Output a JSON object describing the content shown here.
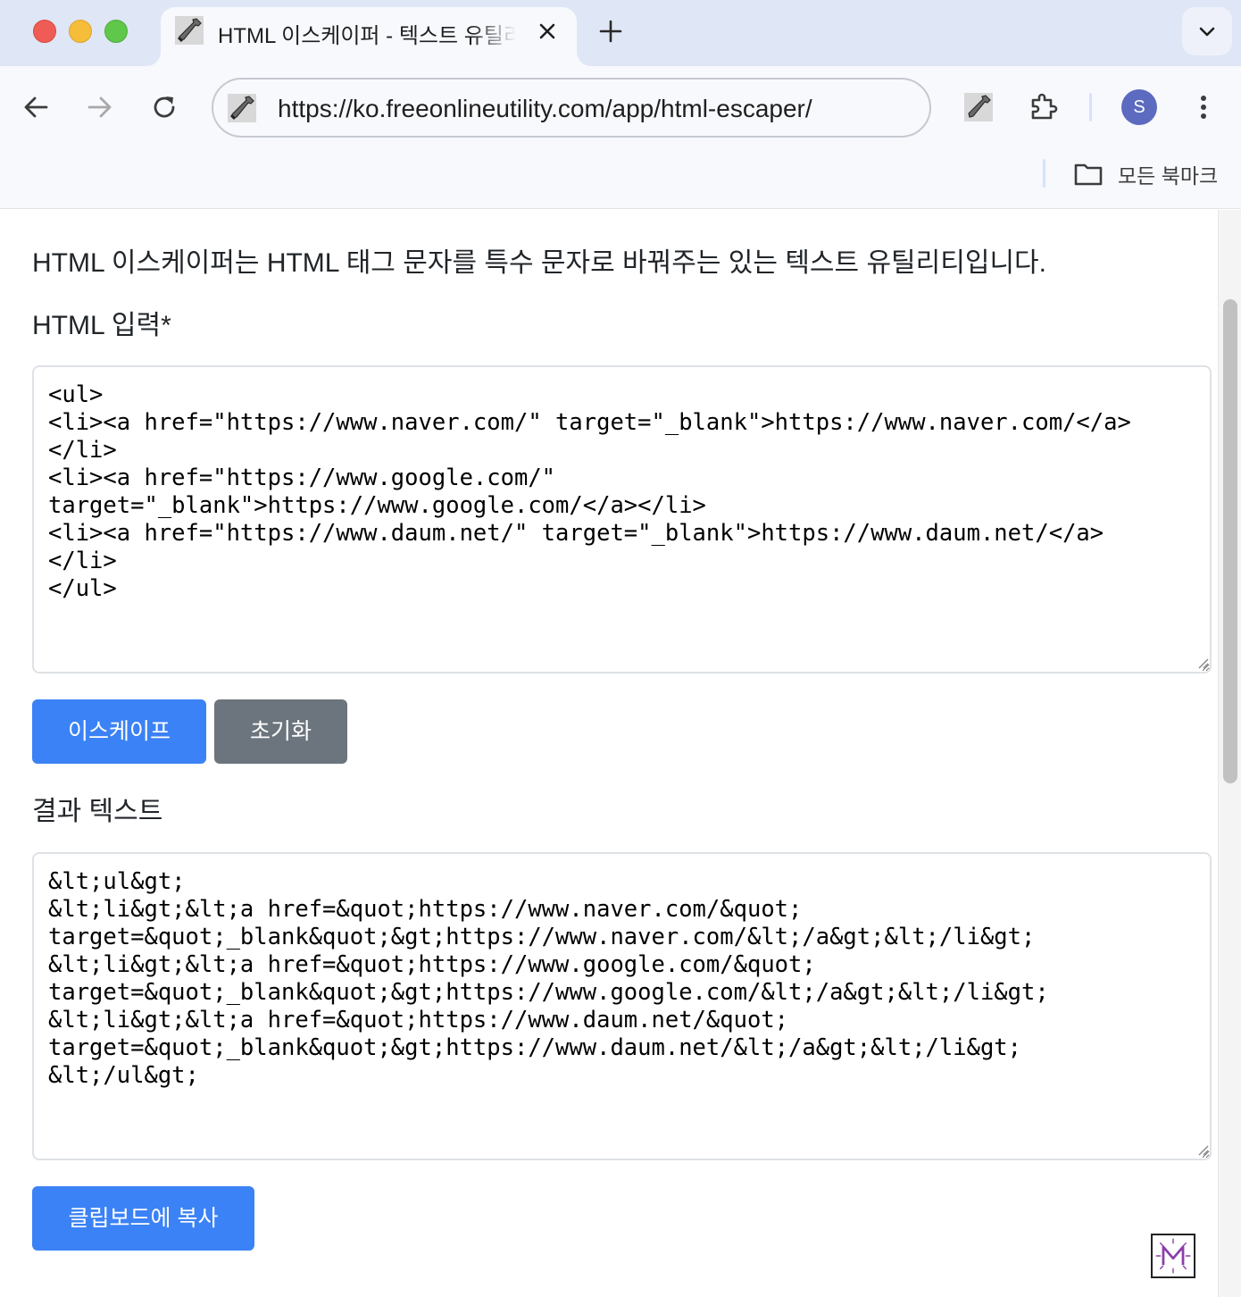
{
  "browser": {
    "tab_title": "HTML 이스케이퍼 - 텍스트 유틸리티",
    "url": "https://ko.freeonlineutility.com/app/html-escaper/",
    "profile_initial": "S",
    "bookmarks_label": "모든 북마크"
  },
  "page": {
    "description": "HTML 이스케이퍼는 HTML 태그 문자를 특수 문자로 바꿔주는 있는 텍스트 유틸리티입니다.",
    "input_label": "HTML 입력*",
    "input_value": "<ul>\n<li><a href=\"https://www.naver.com/\" target=\"_blank\">https://www.naver.com/</a>\n</li>\n<li><a href=\"https://www.google.com/\"\ntarget=\"_blank\">https://www.google.com/</a></li>\n<li><a href=\"https://www.daum.net/\" target=\"_blank\">https://www.daum.net/</a>\n</li>\n</ul>",
    "escape_button": "이스케이프",
    "reset_button": "초기화",
    "result_label": "결과 텍스트",
    "result_value": "&lt;ul&gt;\n&lt;li&gt;&lt;a href=&quot;https://www.naver.com/&quot;\ntarget=&quot;_blank&quot;&gt;https://www.naver.com/&lt;/a&gt;&lt;/li&gt;\n&lt;li&gt;&lt;a href=&quot;https://www.google.com/&quot;\ntarget=&quot;_blank&quot;&gt;https://www.google.com/&lt;/a&gt;&lt;/li&gt;\n&lt;li&gt;&lt;a href=&quot;https://www.daum.net/&quot;\ntarget=&quot;_blank&quot;&gt;https://www.daum.net/&lt;/a&gt;&lt;/li&gt;\n&lt;/ul&gt;",
    "copy_button": "클립보드에 복사"
  },
  "colors": {
    "primary": "#3b82f6",
    "secondary": "#6c757d",
    "tabbar": "#dfe6f6",
    "toolbar": "#f8f9fd"
  },
  "icons": [
    "wrench-favicon-icon",
    "close-icon",
    "plus-icon",
    "chevron-down-icon",
    "back-arrow-icon",
    "forward-arrow-icon",
    "reload-icon",
    "extension-puzzle-icon",
    "kebab-menu-icon",
    "folder-icon",
    "m-logo-icon"
  ]
}
